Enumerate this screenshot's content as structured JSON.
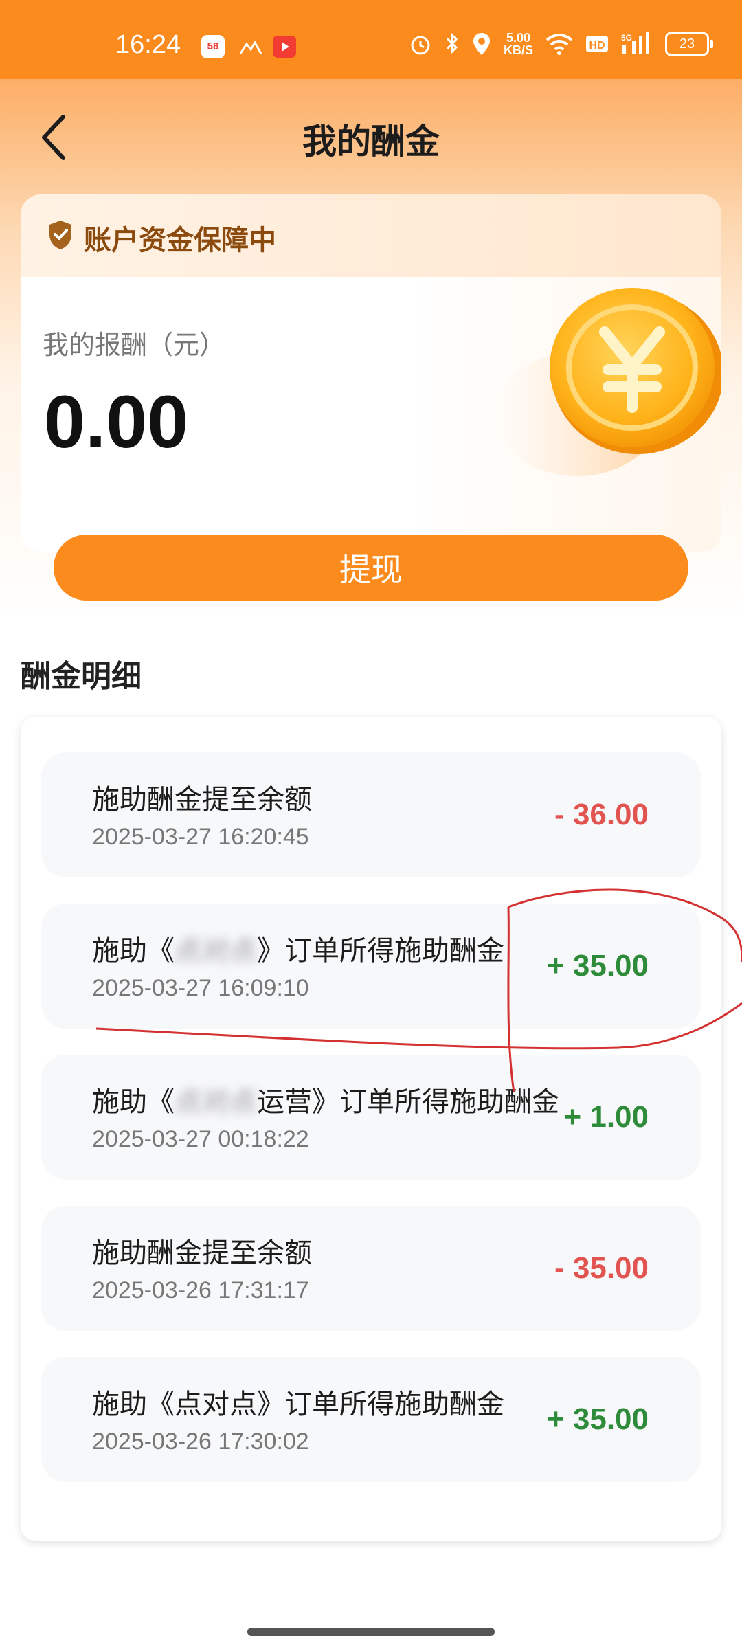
{
  "status_bar": {
    "time": "16:24",
    "net_speed_value": "5.00",
    "net_speed_unit": "KB/S",
    "battery": "23"
  },
  "header": {
    "title": "我的酬金"
  },
  "account": {
    "secure_text": "账户资金保障中",
    "reward_label": "我的报酬（元）",
    "reward_amount": "0.00"
  },
  "withdraw_label": "提现",
  "details": {
    "title": "酬金明细",
    "items": [
      {
        "prefix": "施助酬金提至余额",
        "blurred": "",
        "suffix": "",
        "time": "2025-03-27 16:20:45",
        "amount": "- 36.00",
        "sign": "neg"
      },
      {
        "prefix": "施助《",
        "blurred": "点对点",
        "suffix": "》订单所得施助酬金",
        "time": "2025-03-27 16:09:10",
        "amount": "+ 35.00",
        "sign": "pos"
      },
      {
        "prefix": "施助《",
        "blurred": "点对点",
        "suffix": "运营》订单所得施助酬金",
        "time": "2025-03-27 00:18:22",
        "amount": "+ 1.00",
        "sign": "pos"
      },
      {
        "prefix": "施助酬金提至余额",
        "blurred": "",
        "suffix": "",
        "time": "2025-03-26 17:31:17",
        "amount": "- 35.00",
        "sign": "neg"
      },
      {
        "prefix": "施助《点对点》订单所得施助酬金",
        "blurred": "",
        "suffix": "",
        "time": "2025-03-26 17:30:02",
        "amount": "+ 35.00",
        "sign": "pos"
      }
    ]
  },
  "colors": {
    "accent": "#fb8b1c",
    "negative": "#e2544f",
    "positive": "#2e8b3a"
  }
}
